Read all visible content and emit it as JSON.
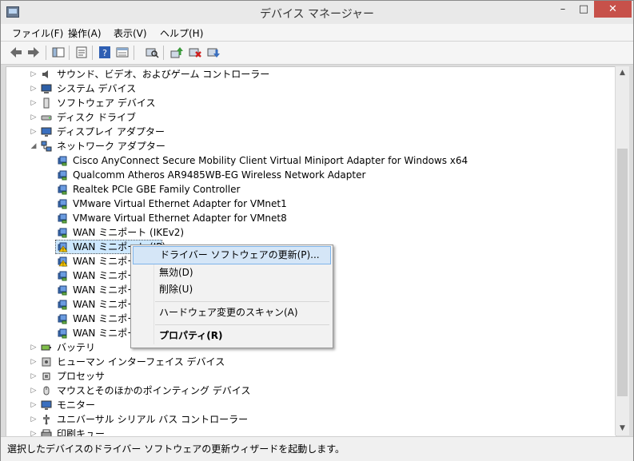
{
  "window": {
    "title": "デバイス マネージャー",
    "min": "–",
    "max": "□",
    "close": "✕"
  },
  "menu": [
    "ファイル(F)",
    "操作(A)",
    "表示(V)",
    "ヘルプ(H)"
  ],
  "tree": {
    "categories_top": [
      {
        "label": "サウンド、ビデオ、およびゲーム コントローラー",
        "icon": "speaker-icon"
      },
      {
        "label": "システム デバイス",
        "icon": "computer-icon"
      },
      {
        "label": "ソフトウェア デバイス",
        "icon": "device-icon"
      },
      {
        "label": "ディスク ドライブ",
        "icon": "disk-icon"
      },
      {
        "label": "ディスプレイ アダプター",
        "icon": "monitor-icon"
      },
      {
        "label": "ネットワーク アダプター",
        "icon": "network-icon"
      }
    ],
    "network_children": [
      {
        "label": "Cisco AnyConnect Secure Mobility Client Virtual Miniport Adapter for Windows x64",
        "warning": false
      },
      {
        "label": "Qualcomm Atheros AR9485WB-EG Wireless Network Adapter",
        "warning": false
      },
      {
        "label": "Realtek PCIe GBE Family Controller",
        "warning": false
      },
      {
        "label": "VMware Virtual Ethernet Adapter for VMnet1",
        "warning": false
      },
      {
        "label": "VMware Virtual Ethernet Adapter for VMnet8",
        "warning": false
      },
      {
        "label": "WAN ミニポート (IKEv2)",
        "warning": false
      },
      {
        "label": "WAN ミニポート (IP)",
        "warning": true
      },
      {
        "label": "WAN ミニポート",
        "warning": true
      },
      {
        "label": "WAN ミニポート",
        "warning": false
      },
      {
        "label": "WAN ミニポート",
        "warning": false
      },
      {
        "label": "WAN ミニポート",
        "warning": false
      },
      {
        "label": "WAN ミニポート",
        "warning": false
      },
      {
        "label": "WAN ミニポート",
        "warning": false
      }
    ],
    "categories_bottom": [
      {
        "label": "バッテリ",
        "icon": "battery-icon"
      },
      {
        "label": "ヒューマン インターフェイス デバイス",
        "icon": "hid-icon"
      },
      {
        "label": "プロセッサ",
        "icon": "processor-icon"
      },
      {
        "label": "マウスとそのほかのポインティング デバイス",
        "icon": "mouse-icon"
      },
      {
        "label": "モニター",
        "icon": "monitor-icon"
      },
      {
        "label": "ユニバーサル シリアル バス コントローラー",
        "icon": "usb-icon"
      },
      {
        "label": "印刷キュー",
        "icon": "printer-icon"
      }
    ]
  },
  "context_menu": {
    "update_driver": "ドライバー ソフトウェアの更新(P)...",
    "disable": "無効(D)",
    "uninstall": "削除(U)",
    "scan": "ハードウェア変更のスキャン(A)",
    "properties": "プロパティ(R)"
  },
  "status": "選択したデバイスのドライバー ソフトウェアの更新ウィザードを起動します。",
  "colors": {
    "accent": "#3c7fc1",
    "close": "#c7514a",
    "highlight": "#d5e6f7"
  }
}
